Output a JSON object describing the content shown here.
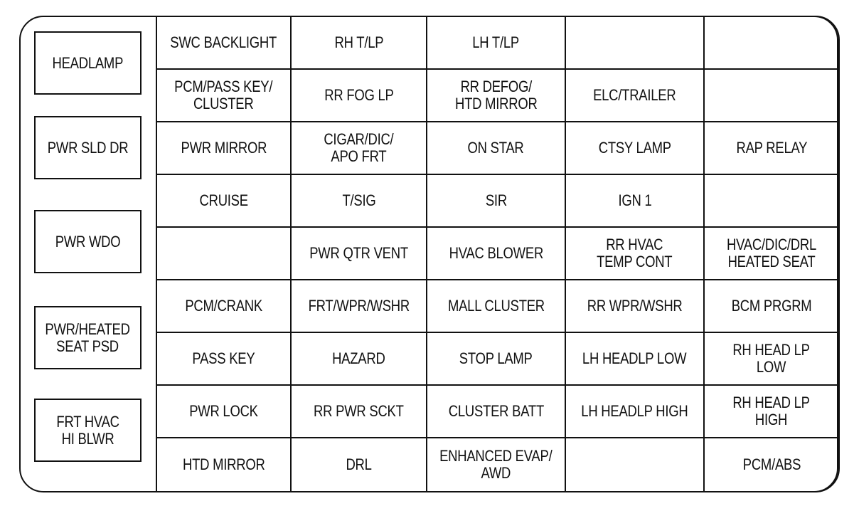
{
  "relays": [
    {
      "label": "HEADLAMP"
    },
    {
      "label": "PWR SLD DR"
    },
    {
      "label": "PWR WDO"
    },
    {
      "label": "PWR/HEATED\nSEAT PSD"
    },
    {
      "label": "FRT HVAC\nHI BLWR"
    }
  ],
  "fuses": [
    [
      "SWC BACKLIGHT",
      "RH T/LP",
      "LH T/LP",
      "",
      ""
    ],
    [
      "PCM/PASS KEY/\nCLUSTER",
      "RR FOG LP",
      "RR DEFOG/\nHTD MIRROR",
      "ELC/TRAILER",
      ""
    ],
    [
      "PWR MIRROR",
      "CIGAR/DIC/\nAPO FRT",
      "ON STAR",
      "CTSY LAMP",
      "RAP RELAY"
    ],
    [
      "CRUISE",
      "T/SIG",
      "SIR",
      "IGN 1",
      ""
    ],
    [
      "",
      "PWR QTR VENT",
      "HVAC BLOWER",
      "RR HVAC\nTEMP CONT",
      "HVAC/DIC/DRL\nHEATED SEAT"
    ],
    [
      "PCM/CRANK",
      "FRT/WPR/WSHR",
      "MALL CLUSTER",
      "RR WPR/WSHR",
      "BCM PRGRM"
    ],
    [
      "PASS KEY",
      "HAZARD",
      "STOP LAMP",
      "LH HEADLP LOW",
      "RH HEAD LP\nLOW"
    ],
    [
      "PWR LOCK",
      "RR PWR SCKT",
      "CLUSTER BATT",
      "LH HEADLP HIGH",
      "RH HEAD LP\nHIGH"
    ],
    [
      "HTD MIRROR",
      "DRL",
      "ENHANCED EVAP/\nAWD",
      "",
      "PCM/ABS"
    ]
  ]
}
